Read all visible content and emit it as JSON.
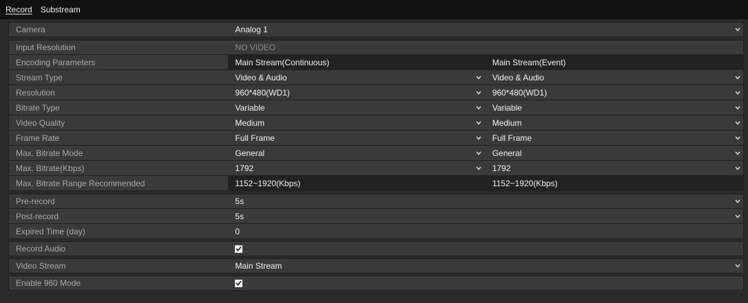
{
  "tabs": [
    {
      "label": "Record",
      "active": true
    },
    {
      "label": "Substream",
      "active": false
    }
  ],
  "rows": {
    "camera": {
      "label": "Camera",
      "value": "Analog 1"
    },
    "input_resolution": {
      "label": "Input Resolution",
      "value": "NO VIDEO"
    },
    "encoding_parameters": {
      "label": "Encoding Parameters",
      "col1": "Main Stream(Continuous)",
      "col2": "Main Stream(Event)"
    },
    "stream_type": {
      "label": "Stream Type",
      "col1": "Video & Audio",
      "col2": "Video & Audio"
    },
    "resolution": {
      "label": "Resolution",
      "col1": "960*480(WD1)",
      "col2": "960*480(WD1)"
    },
    "bitrate_type": {
      "label": "Bitrate Type",
      "col1": "Variable",
      "col2": "Variable"
    },
    "video_quality": {
      "label": "Video Quality",
      "col1": "Medium",
      "col2": "Medium"
    },
    "frame_rate": {
      "label": "Frame Rate",
      "col1": "Full Frame",
      "col2": "Full Frame"
    },
    "max_bitrate_mode": {
      "label": "Max. Bitrate Mode",
      "col1": "General",
      "col2": "General"
    },
    "max_bitrate": {
      "label": "Max. Bitrate(Kbps)",
      "col1": "1792",
      "col2": "1792"
    },
    "max_bitrate_range": {
      "label": "Max. Bitrate Range Recommended",
      "col1": "1152~1920(Kbps)",
      "col2": "1152~1920(Kbps)"
    },
    "pre_record": {
      "label": "Pre-record",
      "value": "5s"
    },
    "post_record": {
      "label": "Post-record",
      "value": "5s"
    },
    "expired_time": {
      "label": "Expired Time (day)",
      "value": "0"
    },
    "record_audio": {
      "label": "Record Audio",
      "checked": true
    },
    "video_stream": {
      "label": "Video Stream",
      "value": "Main Stream"
    },
    "enable_960_mode": {
      "label": "Enable 960 Mode",
      "checked": true
    }
  },
  "colors": {
    "background": "#2a2a2a",
    "tabbar": "#111111",
    "row": "#3a3a3a",
    "header_cell": "#222222",
    "label_text": "#a8a8a8",
    "value_text": "#f2f2f2"
  },
  "icons": {
    "dropdown": "chevron-down-icon",
    "checkbox": "checkbox-checked-icon"
  }
}
